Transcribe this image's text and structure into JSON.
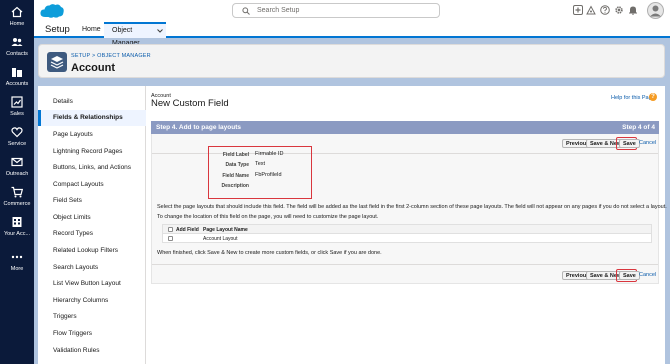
{
  "rail": {
    "items": [
      {
        "label": "Home",
        "icon": "home-icon"
      },
      {
        "label": "Contacts",
        "icon": "contacts-icon"
      },
      {
        "label": "Accounts",
        "icon": "accounts-icon"
      },
      {
        "label": "Sales",
        "icon": "sales-icon"
      },
      {
        "label": "Service",
        "icon": "service-icon"
      },
      {
        "label": "Outreach",
        "icon": "outreach-icon"
      },
      {
        "label": "Commerce",
        "icon": "commerce-icon"
      },
      {
        "label": "Your Acc...",
        "icon": "your-account-icon"
      },
      {
        "label": "More",
        "icon": "more-icon"
      }
    ]
  },
  "header": {
    "search_placeholder": "Search Setup"
  },
  "nav": {
    "app_name": "Setup",
    "tabs": [
      {
        "label": "Home"
      },
      {
        "label": "Object Manager"
      }
    ]
  },
  "page_header": {
    "breadcrumb": "SETUP > OBJECT MANAGER",
    "title": "Account"
  },
  "sidebar": {
    "items": [
      {
        "label": "Details"
      },
      {
        "label": "Fields & Relationships"
      },
      {
        "label": "Page Layouts"
      },
      {
        "label": "Lightning Record Pages"
      },
      {
        "label": "Buttons, Links, and Actions"
      },
      {
        "label": "Compact Layouts"
      },
      {
        "label": "Field Sets"
      },
      {
        "label": "Object Limits"
      },
      {
        "label": "Record Types"
      },
      {
        "label": "Related Lookup Filters"
      },
      {
        "label": "Search Layouts"
      },
      {
        "label": "List View Button Layout"
      },
      {
        "label": "Hierarchy Columns"
      },
      {
        "label": "Triggers"
      },
      {
        "label": "Flow Triggers"
      },
      {
        "label": "Validation Rules"
      }
    ]
  },
  "main": {
    "object_label": "Account",
    "heading": "New Custom Field",
    "help_link": "Help for this Page",
    "step_title": "Step 4. Add to page layouts",
    "step_count": "Step 4 of 4",
    "buttons": {
      "previous": "Previous",
      "save_new": "Save & New",
      "save": "Save",
      "cancel": "Cancel"
    },
    "field_info": {
      "label_label": "Field Label",
      "label_value": "Firmable ID",
      "type_label": "Data Type",
      "type_value": "Text",
      "name_label": "Field Name",
      "name_value": "FbProfileId",
      "desc_label": "Description",
      "desc_value": ""
    },
    "para1": "Select the page layouts that should include this field. The field will be added as the last field in the first 2-column section of these page layouts. The field will not appear on any pages if you do not select a layout.",
    "para2": "To change the location of this field on the page, you will need to customize the page layout.",
    "layout_table": {
      "col_add": "Add Field",
      "col_name": "Page Layout Name",
      "rows": [
        {
          "name": "Account Layout",
          "checked": false
        }
      ]
    },
    "para3": "When finished, click Save & New to create more custom fields, or click Save if you are done."
  },
  "colors": {
    "rail_bg": "#0b1a3a",
    "brand_blue": "#0176d3",
    "step_bar": "#8b9ac2",
    "highlight_red": "#d9363e"
  }
}
